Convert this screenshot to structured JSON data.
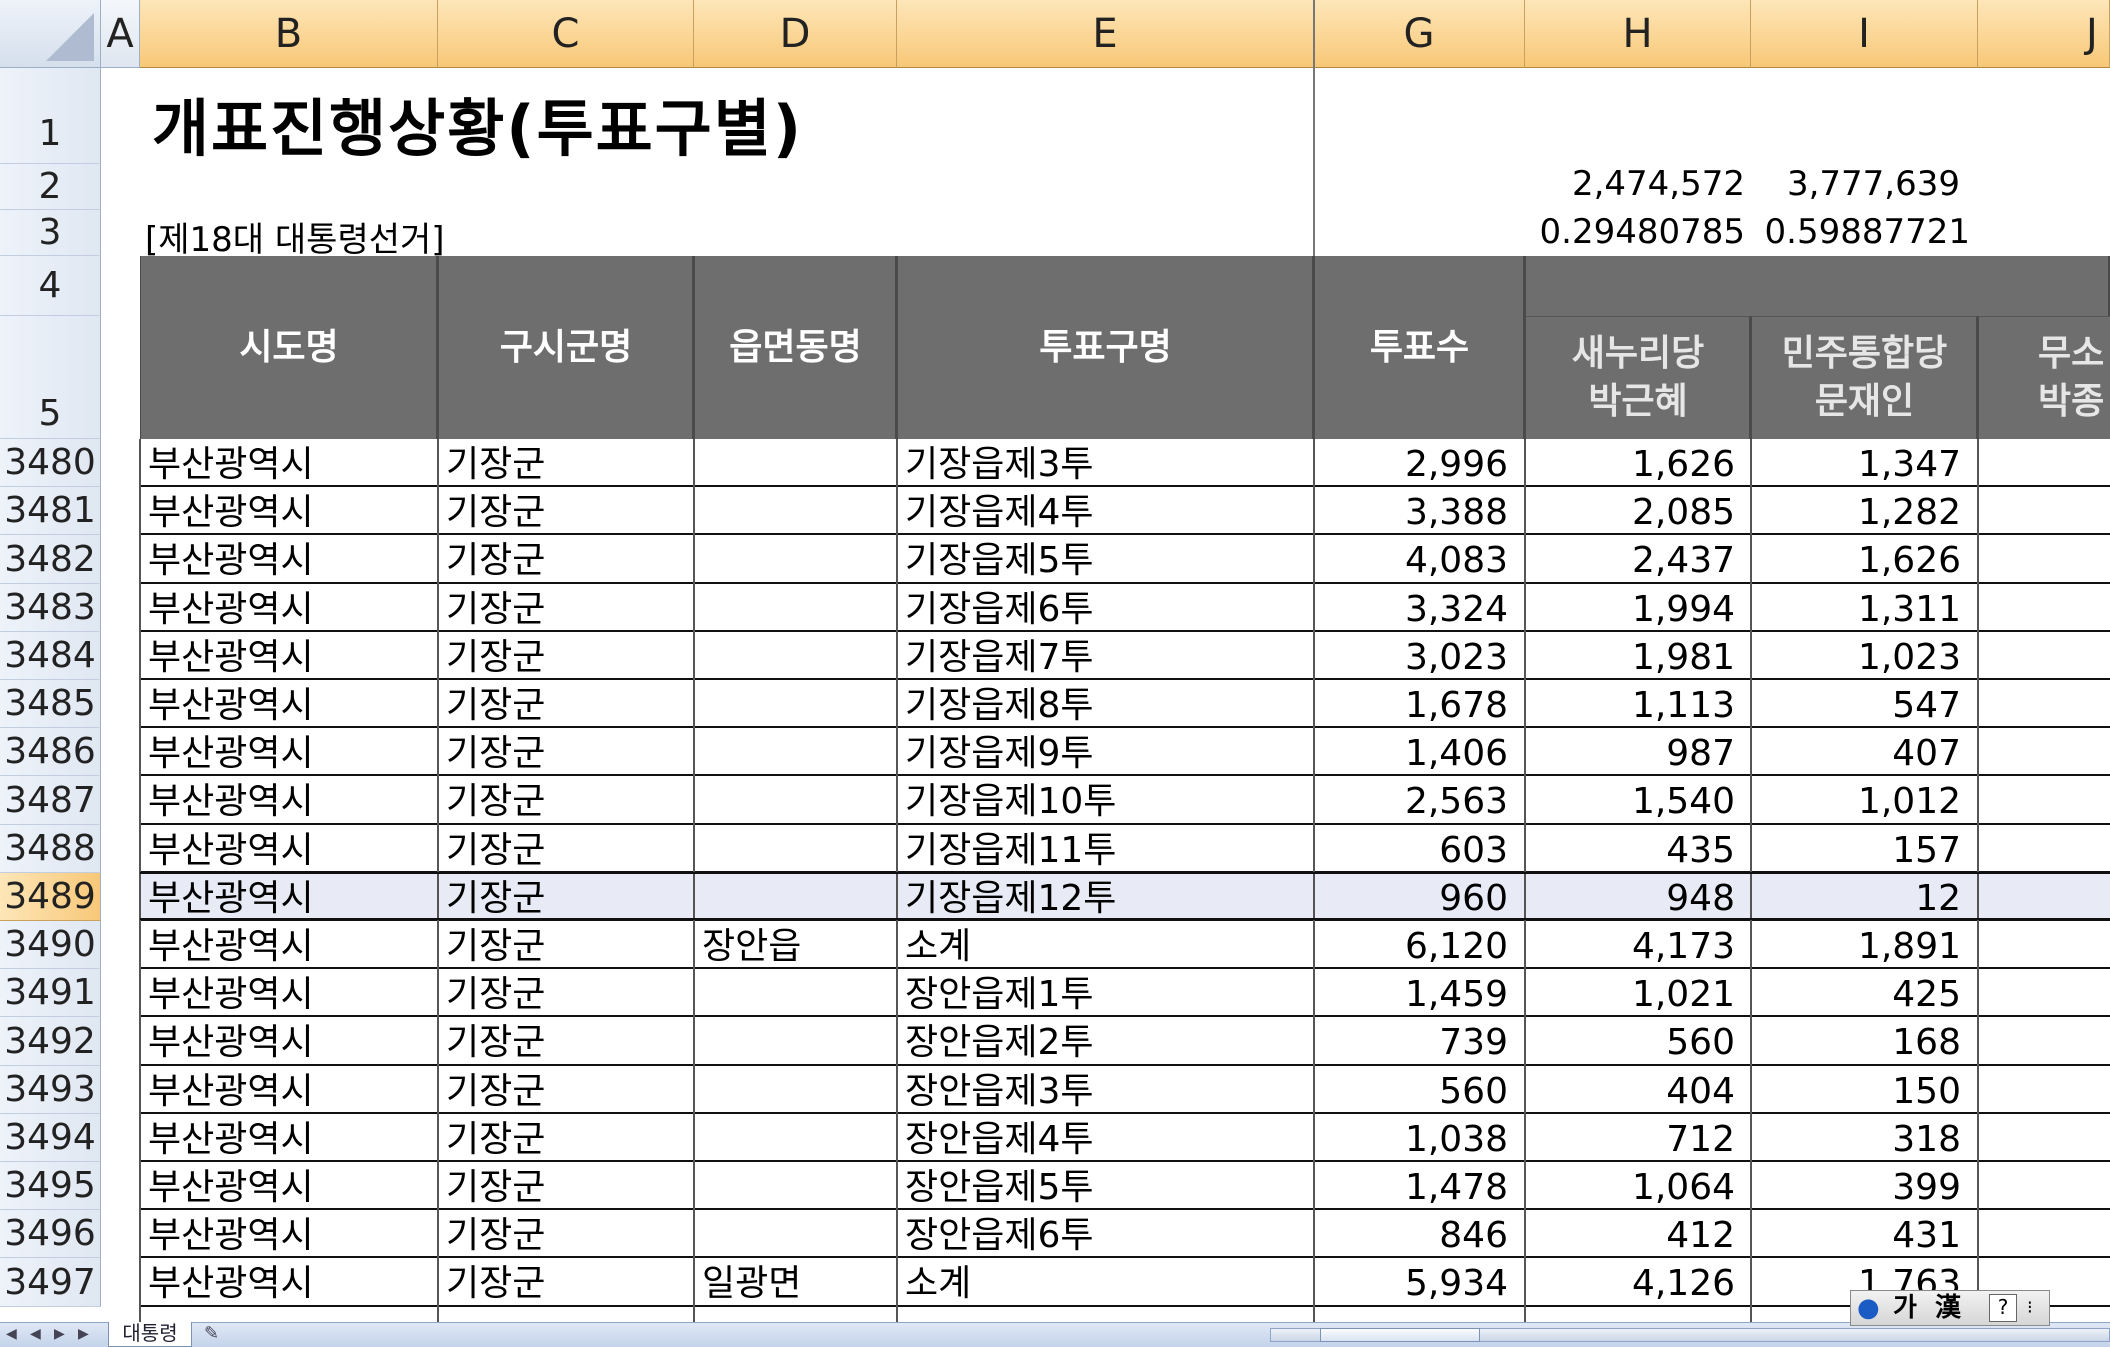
{
  "columns": [
    "A",
    "B",
    "C",
    "D",
    "E",
    "G",
    "H",
    "I",
    "J"
  ],
  "title": "개표진행상황(투표구별)",
  "subtitle": "[제18대 대통령선거]",
  "top_values": {
    "h_row2": "2,474,572",
    "i_row2": "3,777,639",
    "h_row3": "0.29480785",
    "i_row3": "0.59887721"
  },
  "top_row_numbers": [
    "1",
    "2",
    "3",
    "4",
    "5"
  ],
  "headers": {
    "sido": "시도명",
    "gusigun": "구시군명",
    "eupmyeon": "읍면동명",
    "tupyogu": "투표구명",
    "tupyosu": "투표수",
    "party_h_1": "새누리당",
    "party_h_2": "박근혜",
    "party_i_1": "민주통합당",
    "party_i_2": "문재인",
    "party_j_1": "무소",
    "party_j_2": "박종"
  },
  "rows": [
    {
      "row": "3480",
      "sido": "부산광역시",
      "gusigun": "기장군",
      "eupmyeon": "",
      "tupyogu": "기장읍제3투",
      "tupyosu": "2,996",
      "h": "1,626",
      "i": "1,347"
    },
    {
      "row": "3481",
      "sido": "부산광역시",
      "gusigun": "기장군",
      "eupmyeon": "",
      "tupyogu": "기장읍제4투",
      "tupyosu": "3,388",
      "h": "2,085",
      "i": "1,282"
    },
    {
      "row": "3482",
      "sido": "부산광역시",
      "gusigun": "기장군",
      "eupmyeon": "",
      "tupyogu": "기장읍제5투",
      "tupyosu": "4,083",
      "h": "2,437",
      "i": "1,626"
    },
    {
      "row": "3483",
      "sido": "부산광역시",
      "gusigun": "기장군",
      "eupmyeon": "",
      "tupyogu": "기장읍제6투",
      "tupyosu": "3,324",
      "h": "1,994",
      "i": "1,311"
    },
    {
      "row": "3484",
      "sido": "부산광역시",
      "gusigun": "기장군",
      "eupmyeon": "",
      "tupyogu": "기장읍제7투",
      "tupyosu": "3,023",
      "h": "1,981",
      "i": "1,023"
    },
    {
      "row": "3485",
      "sido": "부산광역시",
      "gusigun": "기장군",
      "eupmyeon": "",
      "tupyogu": "기장읍제8투",
      "tupyosu": "1,678",
      "h": "1,113",
      "i": "547"
    },
    {
      "row": "3486",
      "sido": "부산광역시",
      "gusigun": "기장군",
      "eupmyeon": "",
      "tupyogu": "기장읍제9투",
      "tupyosu": "1,406",
      "h": "987",
      "i": "407"
    },
    {
      "row": "3487",
      "sido": "부산광역시",
      "gusigun": "기장군",
      "eupmyeon": "",
      "tupyogu": "기장읍제10투",
      "tupyosu": "2,563",
      "h": "1,540",
      "i": "1,012"
    },
    {
      "row": "3488",
      "sido": "부산광역시",
      "gusigun": "기장군",
      "eupmyeon": "",
      "tupyogu": "기장읍제11투",
      "tupyosu": "603",
      "h": "435",
      "i": "157"
    },
    {
      "row": "3489",
      "sido": "부산광역시",
      "gusigun": "기장군",
      "eupmyeon": "",
      "tupyogu": "기장읍제12투",
      "tupyosu": "960",
      "h": "948",
      "i": "12",
      "selected": true
    },
    {
      "row": "3490",
      "sido": "부산광역시",
      "gusigun": "기장군",
      "eupmyeon": "장안읍",
      "tupyogu": "소계",
      "tupyosu": "6,120",
      "h": "4,173",
      "i": "1,891"
    },
    {
      "row": "3491",
      "sido": "부산광역시",
      "gusigun": "기장군",
      "eupmyeon": "",
      "tupyogu": "장안읍제1투",
      "tupyosu": "1,459",
      "h": "1,021",
      "i": "425"
    },
    {
      "row": "3492",
      "sido": "부산광역시",
      "gusigun": "기장군",
      "eupmyeon": "",
      "tupyogu": "장안읍제2투",
      "tupyosu": "739",
      "h": "560",
      "i": "168"
    },
    {
      "row": "3493",
      "sido": "부산광역시",
      "gusigun": "기장군",
      "eupmyeon": "",
      "tupyogu": "장안읍제3투",
      "tupyosu": "560",
      "h": "404",
      "i": "150"
    },
    {
      "row": "3494",
      "sido": "부산광역시",
      "gusigun": "기장군",
      "eupmyeon": "",
      "tupyogu": "장안읍제4투",
      "tupyosu": "1,038",
      "h": "712",
      "i": "318"
    },
    {
      "row": "3495",
      "sido": "부산광역시",
      "gusigun": "기장군",
      "eupmyeon": "",
      "tupyogu": "장안읍제5투",
      "tupyosu": "1,478",
      "h": "1,064",
      "i": "399"
    },
    {
      "row": "3496",
      "sido": "부산광역시",
      "gusigun": "기장군",
      "eupmyeon": "",
      "tupyogu": "장안읍제6투",
      "tupyosu": "846",
      "h": "412",
      "i": "431"
    },
    {
      "row": "3497",
      "sido": "부산광역시",
      "gusigun": "기장군",
      "eupmyeon": "일광면",
      "tupyogu": "소계",
      "tupyosu": "5,934",
      "h": "4,126",
      "i": "1,763"
    }
  ],
  "sheet_tab": "대통령",
  "ime": {
    "label1": "가",
    "label2": "漢",
    "help": "?"
  }
}
